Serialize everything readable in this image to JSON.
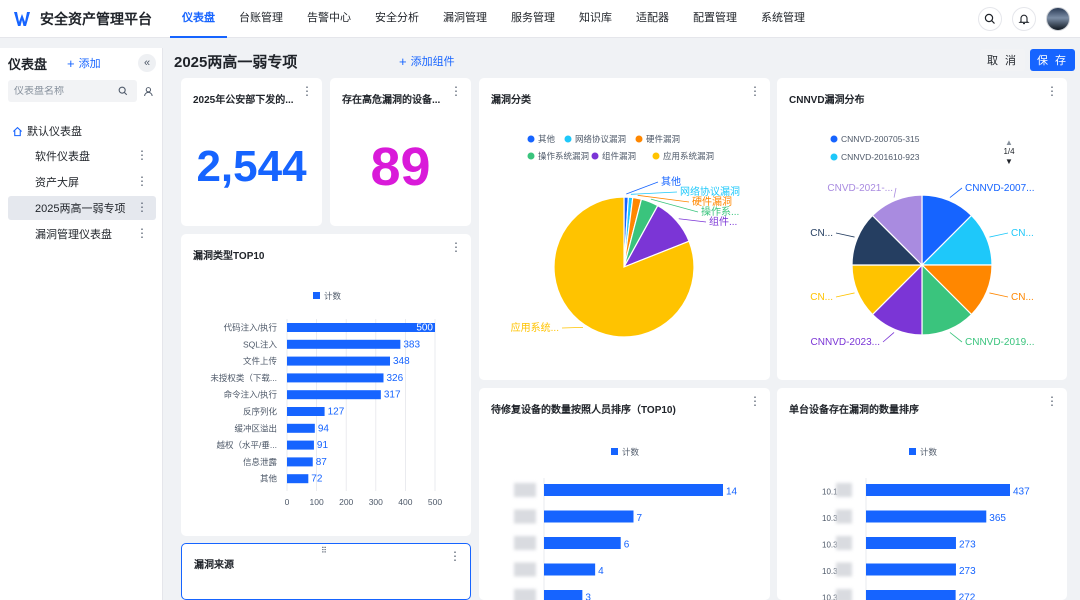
{
  "app": {
    "title": "安全资产管理平台"
  },
  "nav": {
    "items": [
      "仪表盘",
      "台账管理",
      "告警中心",
      "安全分析",
      "漏洞管理",
      "服务管理",
      "知识库",
      "适配器",
      "配置管理",
      "系统管理"
    ],
    "active_index": 0
  },
  "sidebar": {
    "title": "仪表盘",
    "add_label": "添加",
    "search_placeholder": "仪表盘名称",
    "root_label": "默认仪表盘",
    "items": [
      "软件仪表盘",
      "资产大屏",
      "2025两高一弱专项",
      "漏洞管理仪表盘"
    ],
    "active_index": 2
  },
  "page": {
    "title": "2025两高一弱专项",
    "add_widget_label": "添加组件",
    "cancel_label": "取 消",
    "save_label": "保 存"
  },
  "colors": {
    "accent": "#1664ff",
    "kpi_blue": "#1664ff",
    "kpi_magenta": "#d91ad9"
  },
  "cards": {
    "kpi1": {
      "title": "2025年公安部下发的...",
      "value": "2,544"
    },
    "kpi2": {
      "title": "存在高危漏洞的设备...",
      "value": "89"
    },
    "vuln_class": {
      "title": "漏洞分类"
    },
    "cnnvd": {
      "title": "CNNVD漏洞分布",
      "pager": "1/4"
    },
    "top10": {
      "title": "漏洞类型TOP10"
    },
    "pending": {
      "title": "待修复设备的数量按照人员排序（TOP10)"
    },
    "single": {
      "title": "单台设备存在漏洞的数量排序"
    },
    "source": {
      "title": "漏洞来源"
    }
  },
  "chart_data": [
    {
      "type": "pie",
      "title": "漏洞分类",
      "legend_position": "top",
      "categories": [
        "其他",
        "网络协议漏洞",
        "硬件漏洞",
        "操作系统漏洞",
        "组件漏洞",
        "应用系统漏洞"
      ],
      "values": [
        1,
        1,
        2,
        4,
        11,
        81
      ],
      "colors": [
        "#1664ff",
        "#1ec8fa",
        "#ff8700",
        "#3ac47d",
        "#7b35d6",
        "#ffc300"
      ],
      "slice_labels": [
        "其他",
        "网络协议漏洞",
        "硬件漏洞",
        "操作系...",
        "组件...",
        "应用系统..."
      ]
    },
    {
      "type": "pie",
      "title": "CNNVD漏洞分布",
      "legend_position": "top",
      "legend": [
        "CNNVD-200705-315",
        "CNNVD-201610-923"
      ],
      "values": [
        1,
        1,
        1,
        1,
        1,
        1,
        1,
        1
      ],
      "colors": [
        "#1664ff",
        "#1ec8fa",
        "#ff8700",
        "#3ac47d",
        "#7b35d6",
        "#ffc300",
        "#253e61",
        "#a98be0"
      ],
      "slice_labels": [
        "CNNVD-2007...",
        "CN...",
        "CN...",
        "CNNVD-2019...",
        "CNNVD-2023...",
        "CN...",
        "CN...",
        "CNVD-2021-..."
      ]
    },
    {
      "type": "bar",
      "orientation": "horizontal",
      "title": "漏洞类型TOP10",
      "legend": [
        "计数"
      ],
      "categories": [
        "代码注入/执行",
        "SQL注入",
        "文件上传",
        "未授权类（下载...",
        "命令注入/执行",
        "反序列化",
        "缓冲区溢出",
        "越权（水平/垂...",
        "信息泄露",
        "其他"
      ],
      "values": [
        500,
        383,
        348,
        326,
        317,
        127,
        94,
        91,
        87,
        72
      ],
      "value_labels": [
        "500",
        "383",
        "348",
        "326",
        "317",
        "127",
        "94",
        "91",
        "87",
        "72"
      ],
      "xticks": [
        "0",
        "100",
        "200",
        "300",
        "400",
        "500"
      ],
      "xlim": [
        0,
        500
      ],
      "color": "#1664ff"
    },
    {
      "type": "bar",
      "orientation": "horizontal",
      "title": "待修复设备的数量按照人员排序（TOP10)",
      "legend": [
        "计数"
      ],
      "values": [
        14,
        7,
        6,
        4,
        3
      ],
      "value_labels": [
        "14",
        "7",
        "6",
        "4",
        "3"
      ],
      "xlim": [
        0,
        14
      ],
      "color": "#1664ff"
    },
    {
      "type": "bar",
      "orientation": "horizontal",
      "title": "单台设备存在漏洞的数量排序",
      "legend": [
        "计数"
      ],
      "values": [
        437,
        365,
        273,
        273,
        272
      ],
      "value_labels": [
        "437",
        "365",
        "273",
        "273",
        "272"
      ],
      "category_prefixes": [
        "10.1",
        "10.3",
        "10.3",
        "10.3",
        "10.3"
      ],
      "xlim": [
        0,
        437
      ],
      "color": "#1664ff"
    }
  ]
}
